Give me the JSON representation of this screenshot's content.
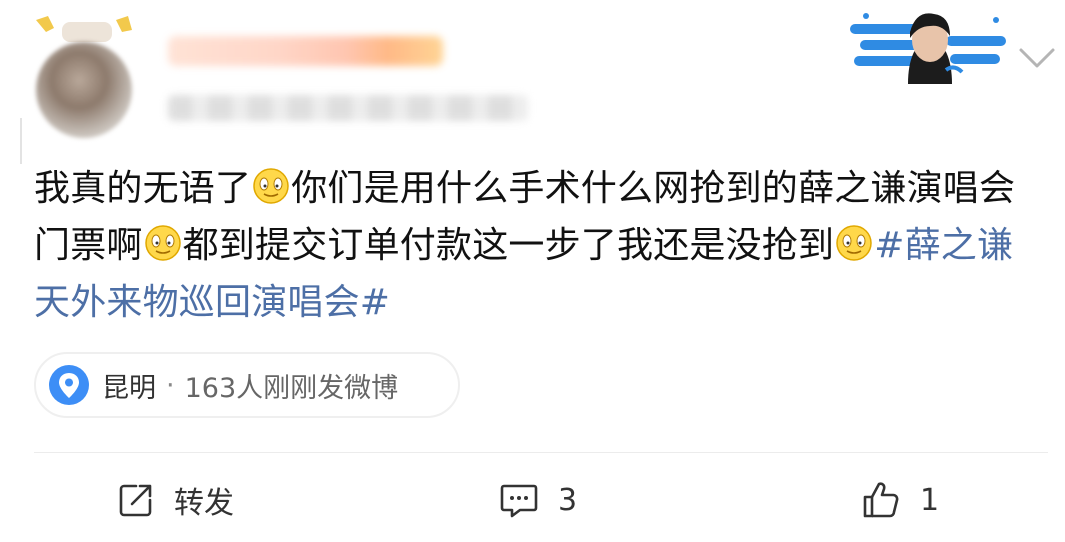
{
  "post": {
    "text_segments": [
      "我真的无语了",
      "你们是用什么手术什么网抢到的薛之谦演唱会门票啊",
      "都到提交订单付款这一步了我还是没抢到",
      "#薛之谦天外来物巡回演唱会#"
    ],
    "emoji": "doge-smile-emoji"
  },
  "location": {
    "city": "昆明",
    "separator": "·",
    "count_text": "163人刚刚发微博"
  },
  "actions": {
    "repost_label": "转发",
    "comment_count": "3",
    "like_count": "1"
  },
  "colors": {
    "hashtag": "#4d6fa6",
    "location_icon": "#3d8ef6",
    "badge_cloud": "#2f8be3"
  }
}
